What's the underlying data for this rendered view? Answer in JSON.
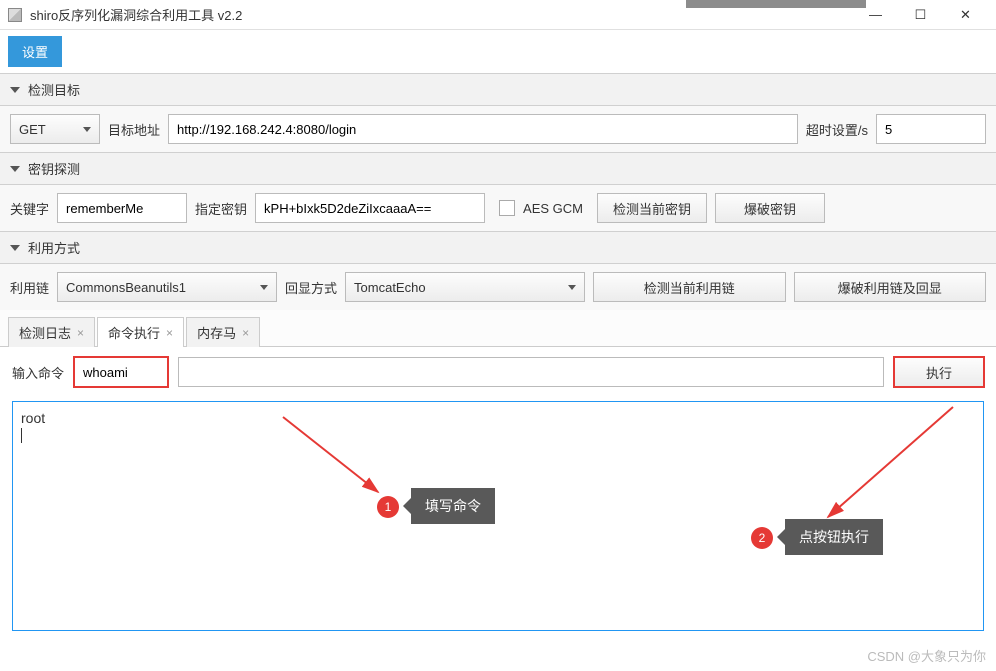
{
  "window": {
    "title": "shiro反序列化漏洞综合利用工具 v2.2"
  },
  "toolbar": {
    "settings_label": "设置"
  },
  "sec_target": {
    "header": "检测目标",
    "method_label": "GET",
    "url_label": "目标地址",
    "url_value": "http://192.168.242.4:8080/login",
    "timeout_label": "超时设置/s",
    "timeout_value": "5"
  },
  "sec_key": {
    "header": "密钥探测",
    "kw_label": "关键字",
    "kw_value": "rememberMe",
    "skey_label": "指定密钥",
    "skey_value": "kPH+bIxk5D2deZiIxcaaaA==",
    "aes_label": "AES GCM",
    "btn_check": "检测当前密钥",
    "btn_brute": "爆破密钥"
  },
  "sec_exploit": {
    "header": "利用方式",
    "chain_label": "利用链",
    "chain_value": "CommonsBeanutils1",
    "echo_label": "回显方式",
    "echo_value": "TomcatEcho",
    "btn_check": "检测当前利用链",
    "btn_brute": "爆破利用链及回显"
  },
  "tabs": [
    {
      "label": "检测日志",
      "closable": true,
      "active": false
    },
    {
      "label": "命令执行",
      "closable": true,
      "active": true
    },
    {
      "label": "内存马",
      "closable": true,
      "active": false
    }
  ],
  "cmd": {
    "label": "输入命令",
    "value": "whoami",
    "exec_label": "执行"
  },
  "output": {
    "text": "root"
  },
  "annotations": {
    "a1_num": "1",
    "a1_text": "填写命令",
    "a2_num": "2",
    "a2_text": "点按钮执行"
  },
  "watermark": "CSDN @大象只为你"
}
